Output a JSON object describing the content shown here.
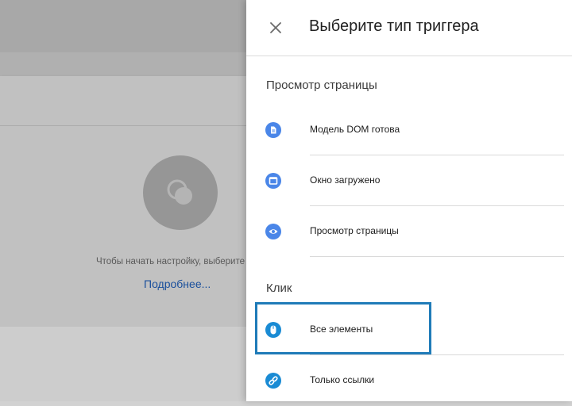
{
  "background": {
    "hint_text": "Чтобы начать настройку, выберите",
    "learn_more_link": "Подробнее..."
  },
  "drawer": {
    "title": "Выберите тип триггера",
    "close_icon": "close-icon",
    "sections": [
      {
        "title": "Просмотр страницы",
        "items": [
          {
            "label": "Модель DOM готова",
            "icon": "document-icon",
            "color": "#4a86e8"
          },
          {
            "label": "Окно загружено",
            "icon": "window-icon",
            "color": "#4a86e8"
          },
          {
            "label": "Просмотр страницы",
            "icon": "eye-icon",
            "color": "#4a86e8"
          }
        ]
      },
      {
        "title": "Клик",
        "items": [
          {
            "label": "Все элементы",
            "icon": "mouse-icon",
            "color": "#1a8bd4",
            "highlighted": true
          },
          {
            "label": "Только ссылки",
            "icon": "link-icon",
            "color": "#1a8bd4"
          }
        ]
      }
    ]
  },
  "colors": {
    "page_view_icon": "#4a86e8",
    "click_icon": "#1a8bd4",
    "highlight_border": "#1f7bb8",
    "link_text": "#1a4f9c"
  }
}
